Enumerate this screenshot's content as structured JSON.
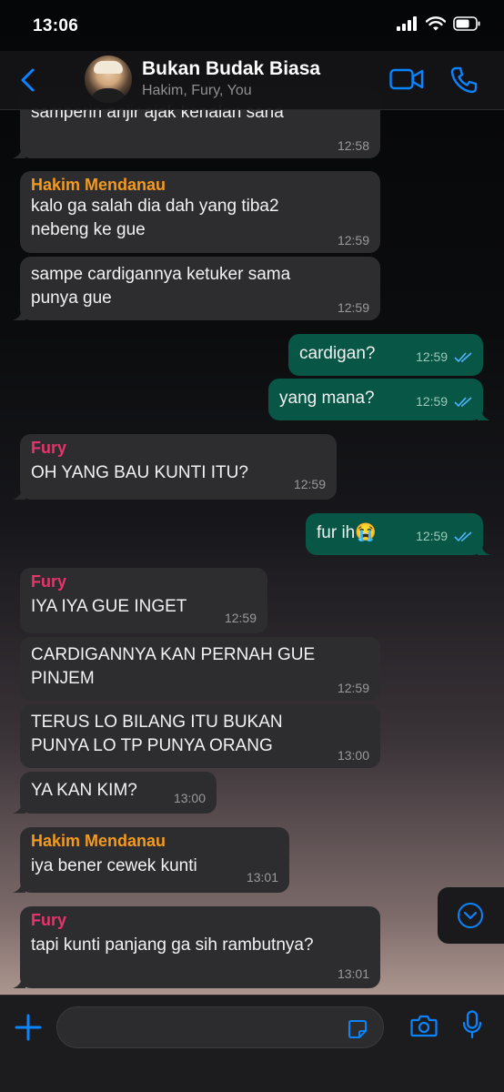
{
  "status_bar": {
    "time": "13:06"
  },
  "header": {
    "title": "Bukan Budak Biasa",
    "subtitle": "Hakim, Fury, You",
    "icons": [
      "back-chevron-icon",
      "video-call-icon",
      "phone-call-icon"
    ]
  },
  "messages": [
    {
      "dir": "in",
      "sender": "",
      "text": "samperin anjir ajak kenalan sana",
      "time": "12:58"
    },
    {
      "dir": "in",
      "sender": "Hakim Mendanau",
      "text": "kalo ga salah dia dah yang tiba2 nebeng ke gue",
      "time": "12:59"
    },
    {
      "dir": "in",
      "sender": "",
      "text": "sampe cardigannya ketuker sama punya gue",
      "time": "12:59"
    },
    {
      "dir": "out",
      "text": "cardigan?",
      "time": "12:59"
    },
    {
      "dir": "out",
      "text": "yang mana?",
      "time": "12:59"
    },
    {
      "dir": "in",
      "sender": "Fury",
      "text": "OH YANG BAU KUNTI ITU?",
      "time": "12:59"
    },
    {
      "dir": "out",
      "text": "fur ih😭",
      "time": "12:59"
    },
    {
      "dir": "in",
      "sender": "Fury",
      "text": "IYA IYA GUE INGET",
      "time": "12:59"
    },
    {
      "dir": "in",
      "sender": "",
      "text": "CARDIGANNYA KAN PERNAH GUE PINJEM",
      "time": "12:59"
    },
    {
      "dir": "in",
      "sender": "",
      "text": "TERUS LO BILANG ITU BUKAN PUNYA LO TP PUNYA ORANG",
      "time": "13:00"
    },
    {
      "dir": "in",
      "sender": "",
      "text": "YA KAN KIM?",
      "time": "13:00"
    },
    {
      "dir": "in",
      "sender": "Hakim Mendanau",
      "text": "iya bener cewek kunti",
      "time": "13:01"
    },
    {
      "dir": "in",
      "sender": "Fury",
      "text": "tapi kunti panjang ga sih rambutnya?",
      "time": "13:01"
    }
  ],
  "colors": {
    "incoming_bubble": "#2d2d30",
    "outgoing_bubble": "#075646",
    "accent_blue": "#0a84ff",
    "hakim_name": "#f49a1c",
    "fury_name": "#e8336b"
  },
  "input_bar": {
    "message_placeholder": "",
    "icons": [
      "plus-icon",
      "sticker-icon",
      "camera-icon",
      "microphone-icon"
    ]
  }
}
